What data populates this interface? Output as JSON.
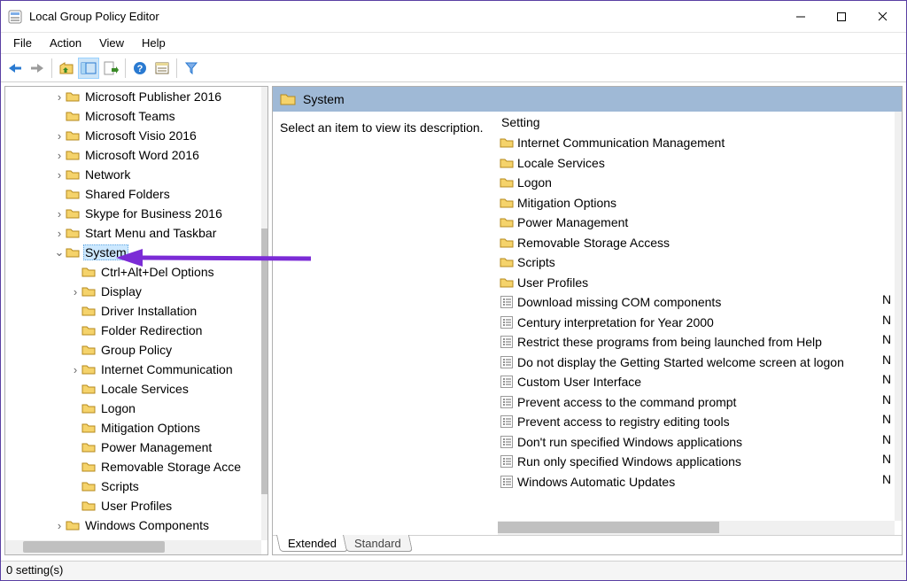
{
  "window": {
    "title": "Local Group Policy Editor"
  },
  "menu": {
    "items": [
      "File",
      "Action",
      "View",
      "Help"
    ]
  },
  "tree": {
    "items": [
      {
        "indent": 3,
        "exp": ">",
        "label": "Microsoft Publisher 2016"
      },
      {
        "indent": 3,
        "exp": "",
        "label": "Microsoft Teams"
      },
      {
        "indent": 3,
        "exp": ">",
        "label": "Microsoft Visio 2016"
      },
      {
        "indent": 3,
        "exp": ">",
        "label": "Microsoft Word 2016"
      },
      {
        "indent": 3,
        "exp": ">",
        "label": "Network"
      },
      {
        "indent": 3,
        "exp": "",
        "label": "Shared Folders"
      },
      {
        "indent": 3,
        "exp": ">",
        "label": "Skype for Business 2016"
      },
      {
        "indent": 3,
        "exp": ">",
        "label": "Start Menu and Taskbar"
      },
      {
        "indent": 3,
        "exp": "v",
        "label": "System",
        "selected": true
      },
      {
        "indent": 4,
        "exp": "",
        "label": "Ctrl+Alt+Del Options"
      },
      {
        "indent": 4,
        "exp": ">",
        "label": "Display"
      },
      {
        "indent": 4,
        "exp": "",
        "label": "Driver Installation"
      },
      {
        "indent": 4,
        "exp": "",
        "label": "Folder Redirection"
      },
      {
        "indent": 4,
        "exp": "",
        "label": "Group Policy"
      },
      {
        "indent": 4,
        "exp": ">",
        "label": "Internet Communication"
      },
      {
        "indent": 4,
        "exp": "",
        "label": "Locale Services"
      },
      {
        "indent": 4,
        "exp": "",
        "label": "Logon"
      },
      {
        "indent": 4,
        "exp": "",
        "label": "Mitigation Options"
      },
      {
        "indent": 4,
        "exp": "",
        "label": "Power Management"
      },
      {
        "indent": 4,
        "exp": "",
        "label": "Removable Storage Acce"
      },
      {
        "indent": 4,
        "exp": "",
        "label": "Scripts"
      },
      {
        "indent": 4,
        "exp": "",
        "label": "User Profiles"
      },
      {
        "indent": 3,
        "exp": ">",
        "label": "Windows Components"
      }
    ]
  },
  "right": {
    "header": "System",
    "description": "Select an item to view its description.",
    "col": "Setting",
    "items": [
      {
        "type": "folder",
        "label": "Internet Communication Management"
      },
      {
        "type": "folder",
        "label": "Locale Services"
      },
      {
        "type": "folder",
        "label": "Logon"
      },
      {
        "type": "folder",
        "label": "Mitigation Options"
      },
      {
        "type": "folder",
        "label": "Power Management"
      },
      {
        "type": "folder",
        "label": "Removable Storage Access"
      },
      {
        "type": "folder",
        "label": "Scripts"
      },
      {
        "type": "folder",
        "label": "User Profiles"
      },
      {
        "type": "policy",
        "label": "Download missing COM components",
        "state": "N"
      },
      {
        "type": "policy",
        "label": "Century interpretation for Year 2000",
        "state": "N"
      },
      {
        "type": "policy",
        "label": "Restrict these programs from being launched from Help",
        "state": "N"
      },
      {
        "type": "policy",
        "label": "Do not display the Getting Started welcome screen at logon",
        "state": "N"
      },
      {
        "type": "policy",
        "label": "Custom User Interface",
        "state": "N"
      },
      {
        "type": "policy",
        "label": "Prevent access to the command prompt",
        "state": "N"
      },
      {
        "type": "policy",
        "label": "Prevent access to registry editing tools",
        "state": "N"
      },
      {
        "type": "policy",
        "label": "Don't run specified Windows applications",
        "state": "N"
      },
      {
        "type": "policy",
        "label": "Run only specified Windows applications",
        "state": "N"
      },
      {
        "type": "policy",
        "label": "Windows Automatic Updates",
        "state": "N"
      }
    ]
  },
  "tabs": {
    "extended": "Extended",
    "standard": "Standard"
  },
  "status": "0 setting(s)"
}
